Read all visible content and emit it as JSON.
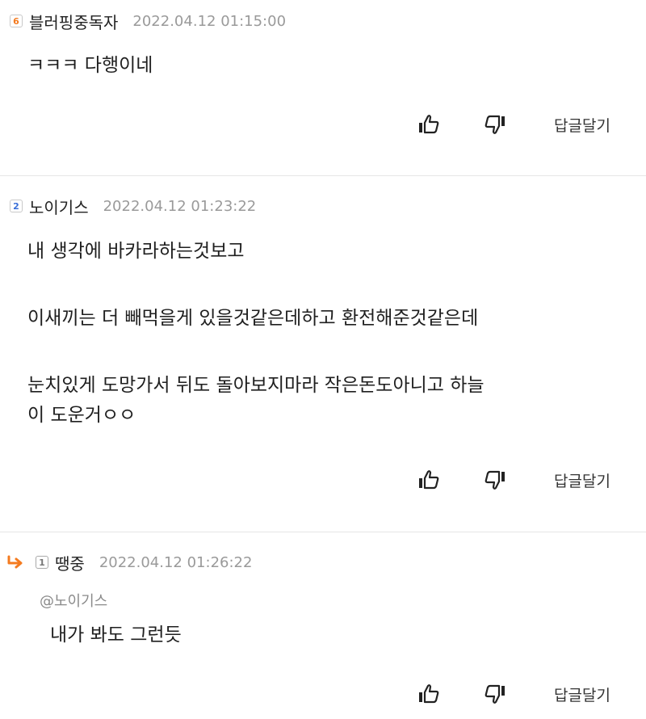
{
  "comments": [
    {
      "badge": "6",
      "badge_icon": "level-6-badge-icon",
      "username": "블러핑중독자",
      "timestamp": "2022.04.12 01:15:00",
      "body": [
        "ㅋㅋㅋ 다행이네"
      ],
      "reply_label": "답글달기"
    },
    {
      "badge": "2",
      "badge_icon": "level-2-badge-icon",
      "username": "노이기스",
      "timestamp": "2022.04.12 01:23:22",
      "body": [
        "내 생각에 바카라하는것보고",
        "이새끼는 더 빼먹을게 있을것같은데하고 환전해준것같은데",
        "눈치있게 도망가서 뒤도 돌아보지마라 작은돈도아니고 하늘",
        "이 도운거ㅇㅇ"
      ],
      "reply_label": "답글달기"
    },
    {
      "is_reply": true,
      "badge": "1",
      "badge_icon": "level-1-badge-icon",
      "username": "땡중",
      "timestamp": "2022.04.12 01:26:22",
      "mention": "@노이기스",
      "body": [
        "내가 봐도 그런듯"
      ],
      "reply_label": "답글달기"
    }
  ],
  "colors": {
    "reply_arrow": "#f47b20",
    "badge_orange": "#f47b20",
    "badge_blue": "#3a6fd8",
    "timestamp": "#9a9a9a",
    "divider": "#e6e6e6"
  },
  "icons": {
    "like": "thumbs-up-icon",
    "dislike": "thumbs-down-icon",
    "reply_indicator": "reply-arrow-icon"
  }
}
